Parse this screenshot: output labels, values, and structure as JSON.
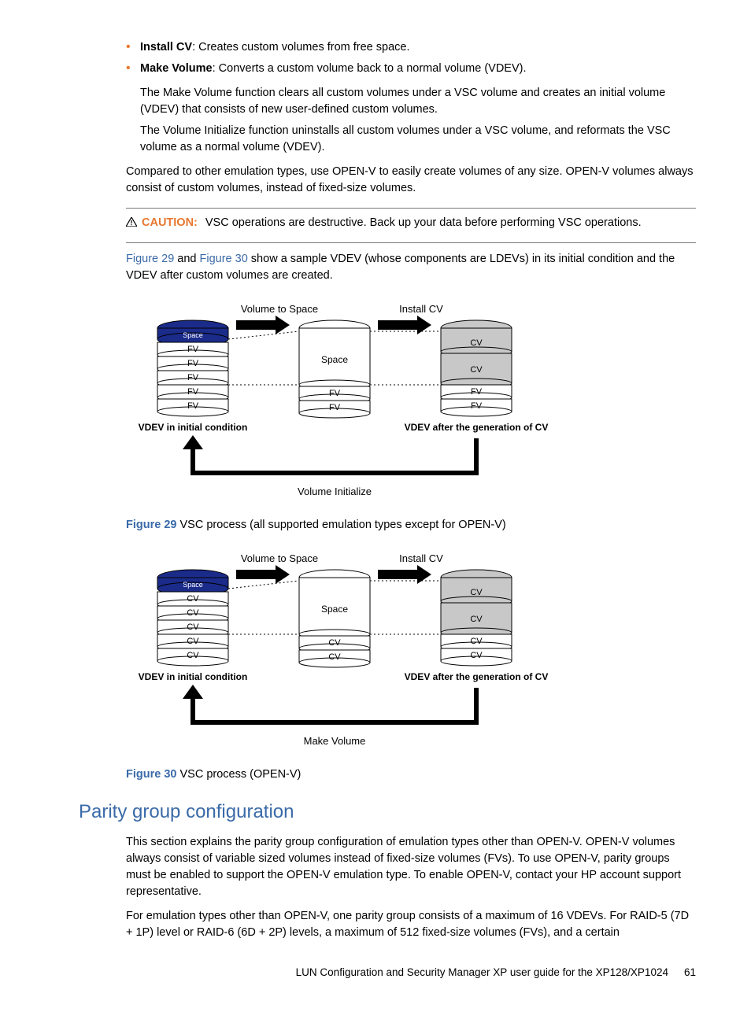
{
  "bullets": [
    {
      "term": "Install CV",
      "desc": ": Creates custom volumes from free space."
    },
    {
      "term": "Make Volume",
      "desc": ": Converts a custom volume back to a normal volume (VDEV)."
    }
  ],
  "sub1": "The Make Volume function clears all custom volumes under a VSC volume and creates an initial volume (VDEV) that consists of new user-defined custom volumes.",
  "sub2": "The Volume Initialize function uninstalls all custom volumes under a VSC volume, and reformats the VSC volume as a normal volume (VDEV).",
  "para_compare": "Compared to other emulation types, use OPEN-V to easily create volumes of any size. OPEN-V volumes always consist of custom volumes, instead of fixed-size volumes.",
  "caution_label": "CAUTION:",
  "caution_text": "VSC operations are destructive. Back up your data before performing VSC operations.",
  "intro_fig": {
    "pre": "",
    "f29": "Figure 29",
    "mid": " and ",
    "f30": "Figure 30",
    "post": " show a sample VDEV (whose components are LDEVs) in its initial condition and the VDEV after custom volumes are created."
  },
  "fig29": {
    "top1": "Volume to Space",
    "top2": "Install CV",
    "space_label": "Space",
    "space_top": "Space",
    "fv": "FV",
    "cv": "CV",
    "left_caption": "VDEV in initial condition",
    "right_caption": "VDEV after the generation of CV",
    "bottom": "Volume Initialize",
    "caption_label": "Figure 29",
    "caption_text": "  VSC process (all supported emulation types except for OPEN-V)"
  },
  "fig30": {
    "top1": "Volume to Space",
    "top2": "Install CV",
    "space_label": "Space",
    "space_top": "Space",
    "cv": "CV",
    "left_caption": "VDEV in initial condition",
    "right_caption": "VDEV after the generation of CV",
    "bottom": "Make Volume",
    "caption_label": "Figure 30",
    "caption_text": "  VSC process (OPEN-V)"
  },
  "section_title": "Parity group configuration",
  "parity_p1": "This section explains the parity group configuration of emulation types other than OPEN-V. OPEN-V volumes always consist of variable sized volumes instead of fixed-size volumes (FVs). To use OPEN-V, parity groups must be enabled to support the OPEN-V emulation type. To enable OPEN-V, contact your HP account support representative.",
  "parity_p2": "For emulation types other than OPEN-V, one parity group consists of a maximum of 16 VDEVs. For RAID-5 (7D + 1P) level or RAID-6 (6D + 2P) levels, a maximum of 512 fixed-size volumes (FVs), and a certain",
  "footer_title": "LUN Configuration and Security Manager XP user guide for the XP128/XP1024",
  "footer_page": "61"
}
